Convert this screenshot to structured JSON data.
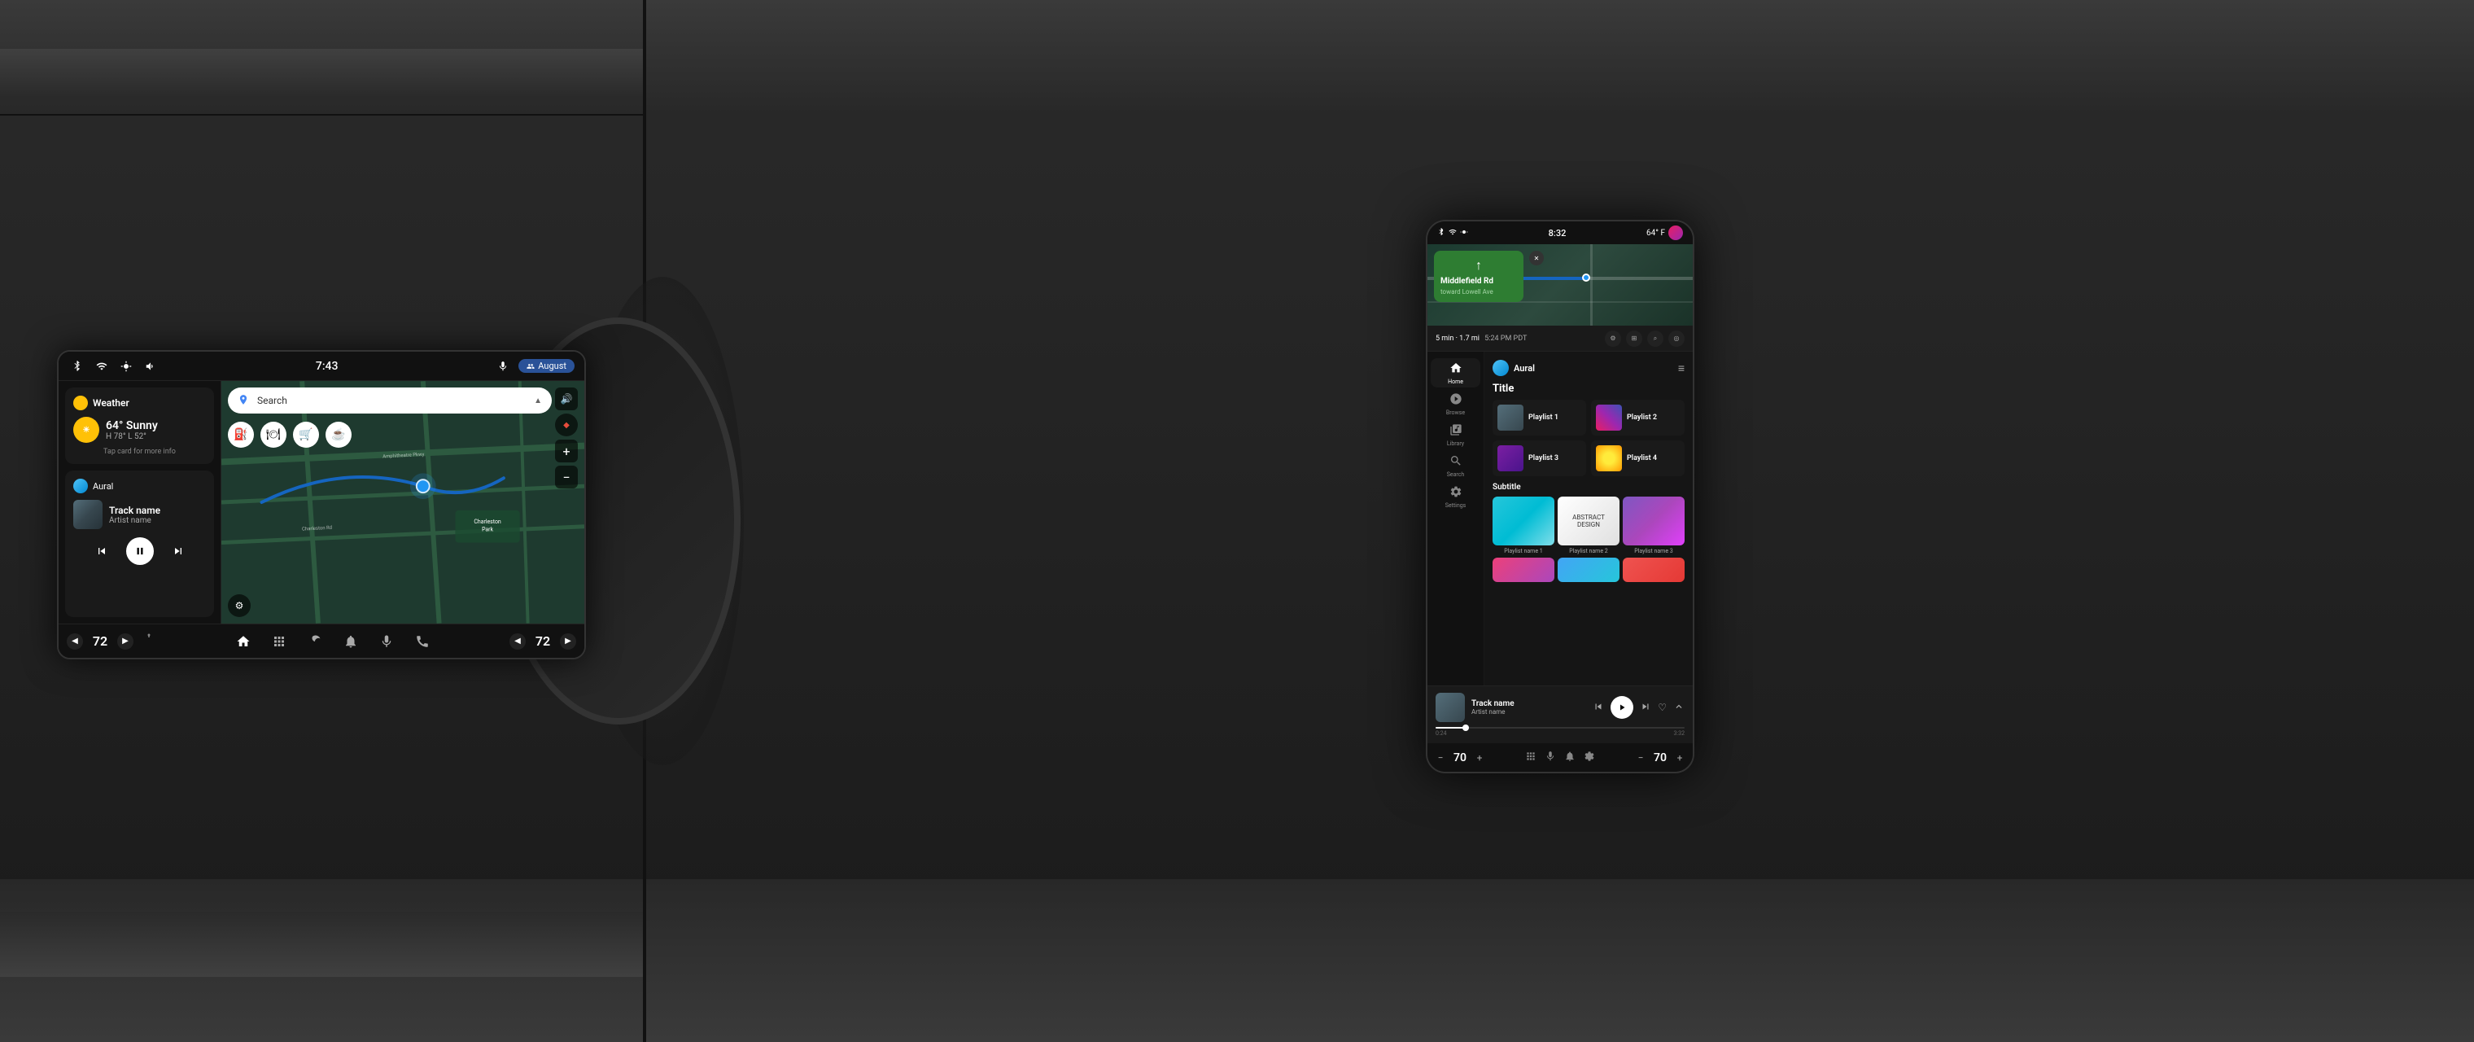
{
  "left": {
    "car_screen": {
      "header": {
        "time": "7:43",
        "location_icon": "📍",
        "mic_icon": "🎤",
        "user_label": "August"
      },
      "weather": {
        "title": "Weather",
        "temp_main": "64° Sunny",
        "temp_high": "H 78°",
        "temp_low": "L 52°",
        "tap_info": "Tap card for more info"
      },
      "music": {
        "app_name": "Aural",
        "track_name": "Track name",
        "artist_name": "Artist name"
      },
      "map": {
        "search_placeholder": "Search"
      },
      "bottom": {
        "temp_left": "72",
        "temp_right": "72"
      }
    }
  },
  "right": {
    "phone_screen": {
      "status_bar": {
        "time": "8:32",
        "temp": "64° F"
      },
      "navigation": {
        "street": "Middlefield Rd",
        "toward": "toward Lowell Ave",
        "eta": "5 min · 1.7 mi",
        "time_label": "5:24 PM PDT"
      },
      "sidebar": {
        "items": [
          {
            "label": "Home",
            "icon": "⌂"
          },
          {
            "label": "Browse",
            "icon": "◎"
          },
          {
            "label": "Library",
            "icon": "≡"
          },
          {
            "label": "Search",
            "icon": "⌕"
          },
          {
            "label": "Settings",
            "icon": "⚙"
          }
        ]
      },
      "content": {
        "section_title": "Title",
        "playlists": [
          {
            "name": "Playlist 1"
          },
          {
            "name": "Playlist 2"
          },
          {
            "name": "Playlist 3"
          },
          {
            "name": "Playlist 4"
          }
        ],
        "subtitle": "Subtitle",
        "subtitle_playlists": [
          {
            "name": "Playlist name 1"
          },
          {
            "name": "Playlist name 2"
          },
          {
            "name": "Playlist name 3"
          }
        ]
      },
      "now_playing": {
        "track_name": "Track name",
        "artist_name": "Artist name",
        "time_current": "0:24",
        "time_total": "3:32"
      },
      "bottom_bar": {
        "temp_left": "70",
        "temp_right": "70"
      }
    }
  }
}
